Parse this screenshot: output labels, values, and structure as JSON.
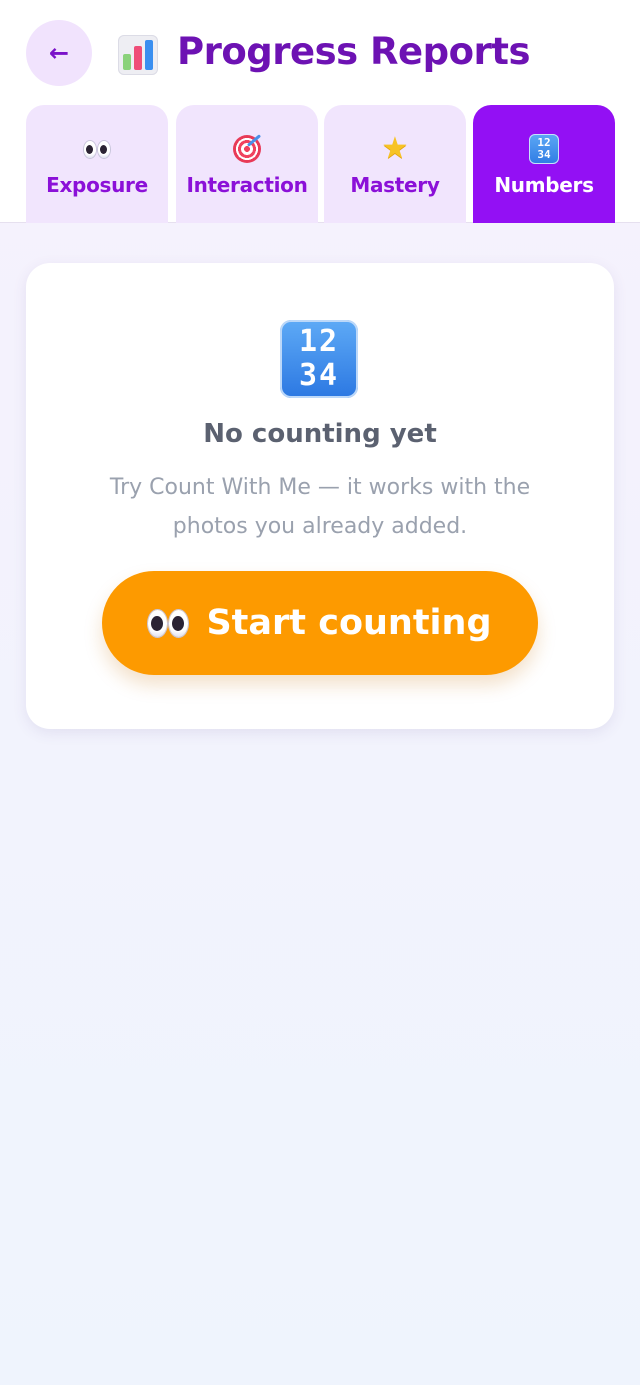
{
  "header": {
    "back_label": "←",
    "title": "Progress Reports",
    "title_icon": "bar-chart-icon"
  },
  "tabs": [
    {
      "label": "Exposure",
      "icon": "eyes-icon",
      "active": false
    },
    {
      "label": "Interaction",
      "icon": "target-icon",
      "active": false
    },
    {
      "label": "Mastery",
      "icon": "star-icon",
      "active": false
    },
    {
      "label": "Numbers",
      "icon": "numbers-icon",
      "active": true
    }
  ],
  "empty_state": {
    "icon": "numbers-icon",
    "icon_glyphs": "1234",
    "title": "No counting yet",
    "description": "Try Count With Me — it works with the photos you already added.",
    "cta_label": "Start counting",
    "cta_icon": "eyes-icon"
  },
  "colors": {
    "accent": "#9310f4",
    "title": "#6d12b3",
    "cta": "#fd9a00"
  }
}
